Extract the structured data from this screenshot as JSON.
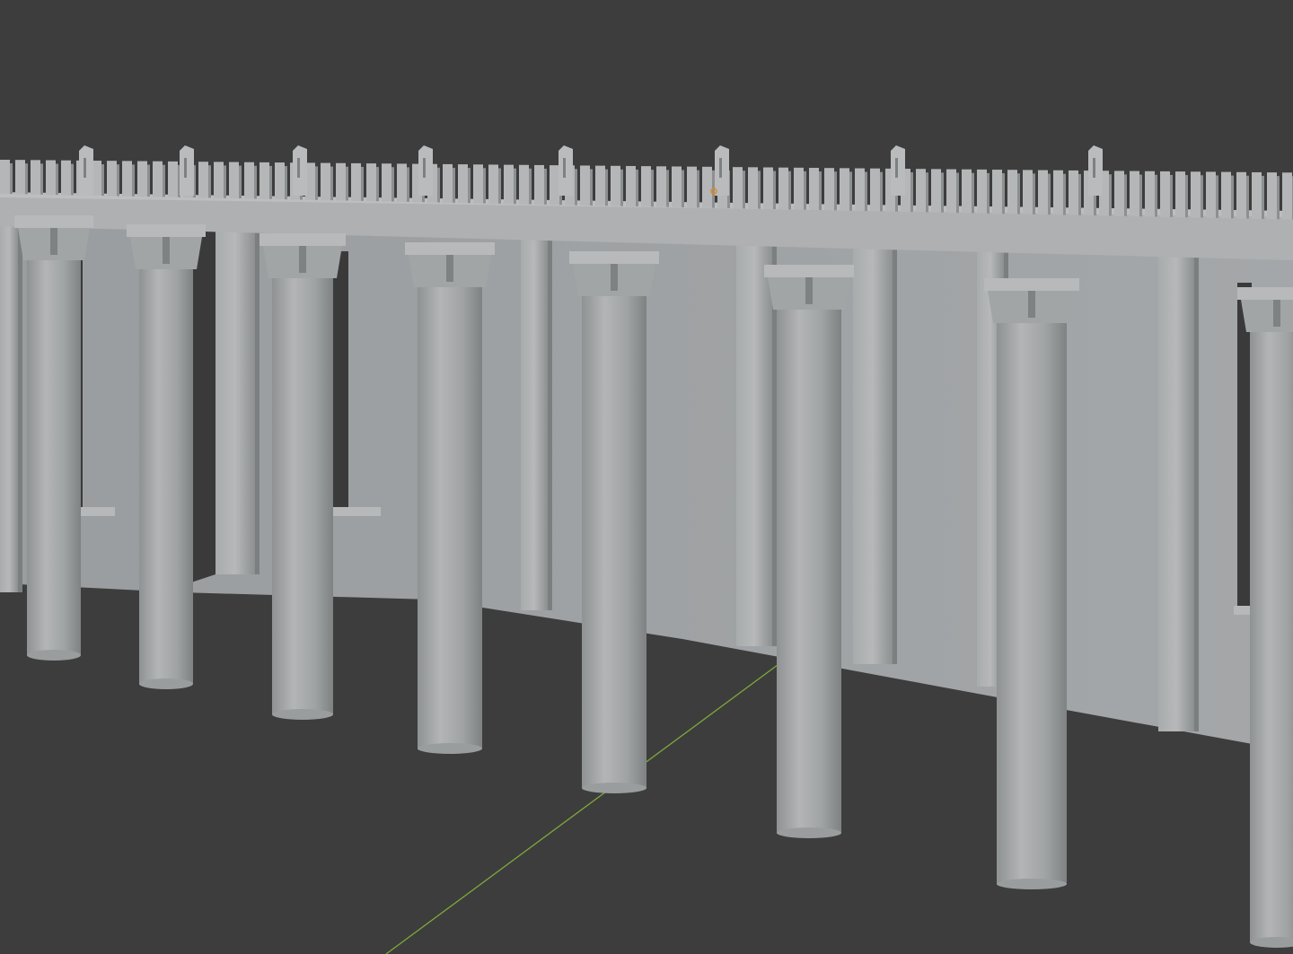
{
  "viewport": {
    "background": "#3d3d3d",
    "mode": "solid-shading",
    "model_color": "#a6a8a9",
    "wall_color": "#9ea1a3",
    "y_axis_color": "#7fa83a",
    "origin_marker_color": "#e08a1e"
  },
  "scene": {
    "objects": [
      {
        "name": "back-wall",
        "type": "mesh"
      },
      {
        "name": "cornice-beam",
        "type": "mesh"
      },
      {
        "name": "crenellation-row",
        "type": "mesh"
      },
      {
        "name": "column-array",
        "type": "mesh",
        "count": 9
      },
      {
        "name": "pilaster-array",
        "type": "mesh"
      },
      {
        "name": "window-openings",
        "type": "mesh"
      }
    ],
    "axes": [
      {
        "name": "y-axis",
        "color": "#7fa83a"
      }
    ],
    "selected_object_origin": true
  }
}
